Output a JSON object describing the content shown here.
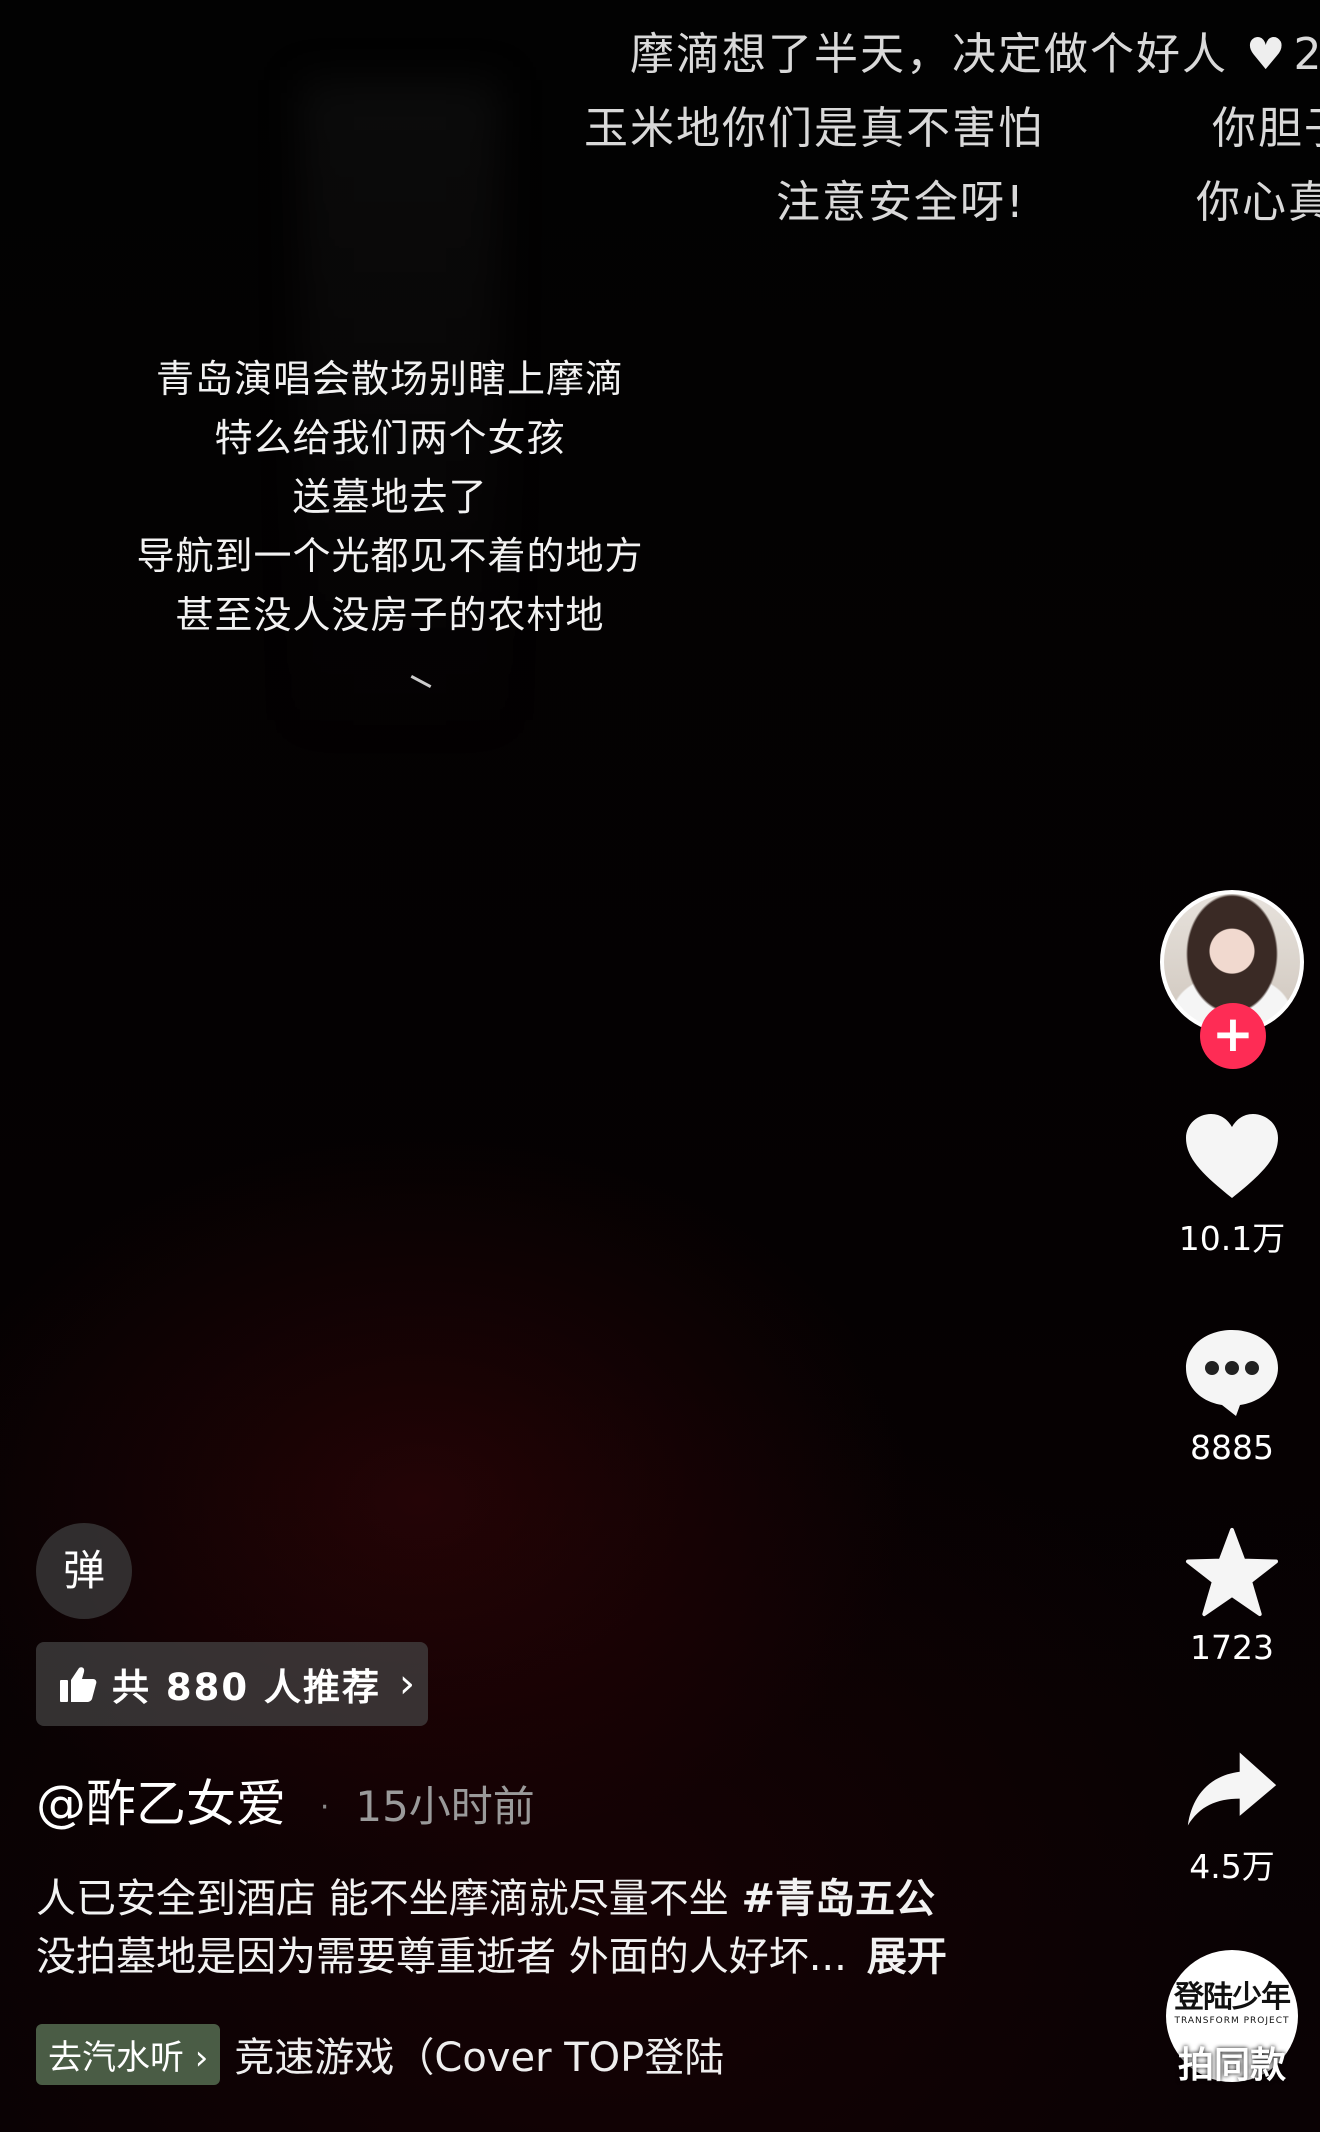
{
  "danmaku": [
    {
      "text": "摩滴想了半天，决定做个好人",
      "suffix": "2"
    },
    {
      "text": "玉米地你们是真不害怕"
    },
    {
      "text": "你胆子"
    },
    {
      "text": "注意安全呀!"
    },
    {
      "text": "你心真"
    }
  ],
  "caption": {
    "lines": [
      "青岛演唱会散场别瞎上摩滴",
      "特么给我们两个女孩",
      "送墓地去了",
      "导航到一个光都见不着的地方",
      "甚至没人没房子的农村地"
    ]
  },
  "rail": {
    "follow_label": "+",
    "likes": "10.1万",
    "comments": "8885",
    "favorites": "1723",
    "shares": "4.5万",
    "same_style_logo": "登陆少年",
    "same_style_logo_sub": "TRANSFORM PROJECT",
    "same_style_label": "拍同款"
  },
  "danmu_toggle": "弹",
  "recommend": {
    "label": "共 880 人推荐",
    "chevron": "›"
  },
  "author": {
    "name": "@酢乙女爱",
    "dot": "·",
    "time": "15小时前"
  },
  "description": {
    "line1": "人已安全到酒店 能不坐摩滴就尽量不坐 ",
    "hashtag": "#青岛五公",
    "line2": "没拍墓地是因为需要尊重逝者 外面的人好坏...",
    "expand": "展开"
  },
  "music": {
    "chip": "去汽水听 ›",
    "title": "竞速游戏（Cover TOP登陆"
  },
  "colors": {
    "follow_red": "#fe2c55",
    "music_chip": "#4a5c45"
  }
}
